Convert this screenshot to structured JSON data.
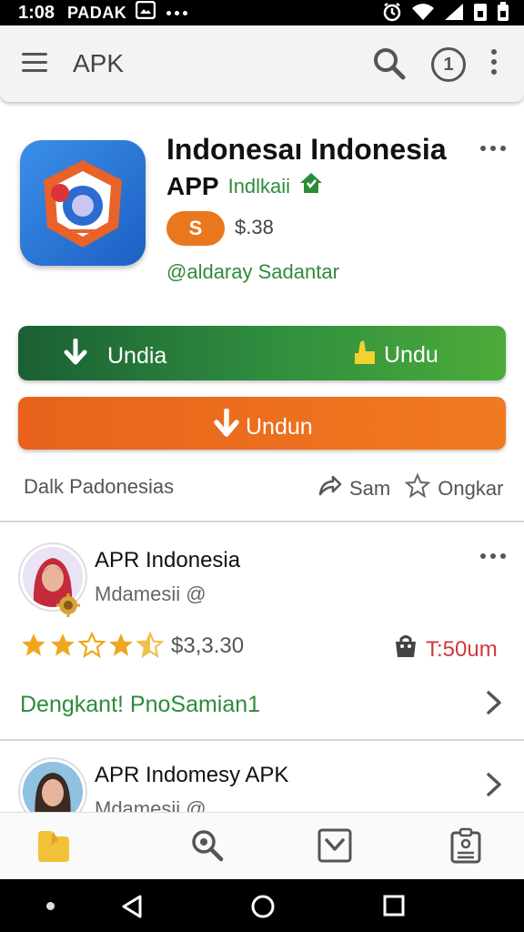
{
  "status_bar": {
    "time": "1:08",
    "carrier": "PADAK"
  },
  "app_bar": {
    "title": "APK",
    "badge": "1"
  },
  "app": {
    "title": "Indonesaı Indonesia",
    "type": "APP",
    "developer": "Indlkaii",
    "pill_label": "S",
    "price": "$.38",
    "handle": "@aldaray Sadantar"
  },
  "buttons": {
    "green_left": "Undia",
    "green_right": "Undu",
    "orange": "Undun"
  },
  "meta": {
    "left": "Dalk Padonesias",
    "share": "Sam",
    "favorite": "Ongkar"
  },
  "review1": {
    "name": "APR Indonesia",
    "user": "Mdamesii @",
    "rating": 3.5,
    "amount": "$3,3.30",
    "time": "T:50um",
    "link": "Dengkant! PnoSamian1"
  },
  "review2": {
    "name": "APR Indomesy APK",
    "user": "Mdamesii @"
  },
  "colors": {
    "accent_green": "#2e8b3a",
    "accent_orange": "#e8771e",
    "warn_red": "#d23a3a"
  }
}
